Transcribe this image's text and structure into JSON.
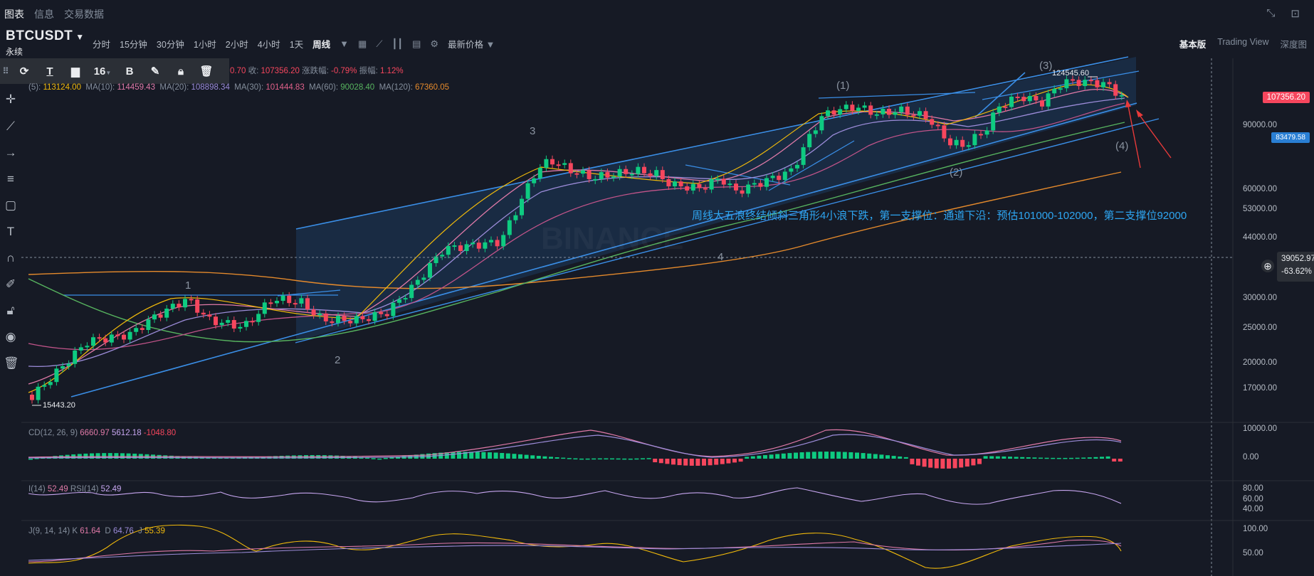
{
  "tabs": [
    {
      "label": "图表",
      "active": true
    },
    {
      "label": "信息",
      "active": false
    },
    {
      "label": "交易数据",
      "active": false
    }
  ],
  "header": {
    "symbol": "BTCUSDT",
    "contract": "永续",
    "intervals": [
      "分时",
      "15分钟",
      "30分钟",
      "1小时",
      "2小时",
      "4小时",
      "1天",
      "周线"
    ],
    "selected_interval": "周线",
    "price_type": "最新价格",
    "view_modes": [
      "基本版",
      "Trading View",
      "深度图"
    ],
    "selected_view": "基本版"
  },
  "drawing_toolbar": {
    "font_size": "16"
  },
  "ohlc": {
    "prev_value": "0.70",
    "close_label": "收:",
    "close": "107356.20",
    "change_label": "涨跌幅:",
    "change": "-0.79%",
    "amp_label": "振幅:",
    "amp": "1.12%"
  },
  "ma": [
    {
      "label": "(5):",
      "value": "113124.00",
      "color": "#f0b90b"
    },
    {
      "label": "MA(10):",
      "value": "114459.43",
      "color": "#e07aa8"
    },
    {
      "label": "MA(20):",
      "value": "108898.34",
      "color": "#9c8cd9"
    },
    {
      "label": "MA(30):",
      "value": "101444.83",
      "color": "#c2548a"
    },
    {
      "label": "MA(60):",
      "value": "90028.40",
      "color": "#57b45f"
    },
    {
      "label": "MA(120):",
      "value": "67360.05",
      "color": "#e58a2c"
    }
  ],
  "price_axis": [
    "90000.00",
    "60000.00",
    "53000.00",
    "44000.00",
    "30000.00",
    "25000.00",
    "20000.00",
    "17000.00"
  ],
  "price_tags": {
    "last": "107356.20",
    "last_color": "#f6465d",
    "ma": "83479.58",
    "ma_color": "#2a7fd4"
  },
  "crosshair": {
    "price": "39052.97",
    "pct": "-63.62%"
  },
  "annotations": {
    "wave_1": "1",
    "wave_2": "2",
    "wave_3": "3",
    "wave_4": "4",
    "wave_p1": "(1)",
    "wave_p2": "(2)",
    "wave_p3": "(3)",
    "wave_p4": "(4)",
    "low_label": "15443.20",
    "high_label": "124545.60",
    "note": "周线大五浪终结倾斜三角形4小浪下跌，第一支撑位：通道下沿：预估101000-102000，第二支撑位92000",
    "watermark": "BINANCE"
  },
  "macd": {
    "label": "CD(12, 26, 9)",
    "dif": "6660.97",
    "dea": "5612.18",
    "hist": "-1048.80",
    "axis": [
      "10000.00",
      "0.00"
    ]
  },
  "rsi": {
    "label1": "I(14)",
    "v1": "52.49",
    "label2": "RSI(14)",
    "v2": "52.49",
    "axis": [
      "80.00",
      "60.00",
      "40.00"
    ]
  },
  "kdj": {
    "label": "J(9, 14, 14)",
    "k_label": "K",
    "k": "61.64",
    "d_label": "D",
    "d": "64.76",
    "j_label": "J",
    "j": "55.39",
    "axis": [
      "100.00",
      "50.00"
    ]
  },
  "colors": {
    "up": "#0ecb81",
    "down": "#f6465d",
    "channel": "#2f7fdc"
  }
}
